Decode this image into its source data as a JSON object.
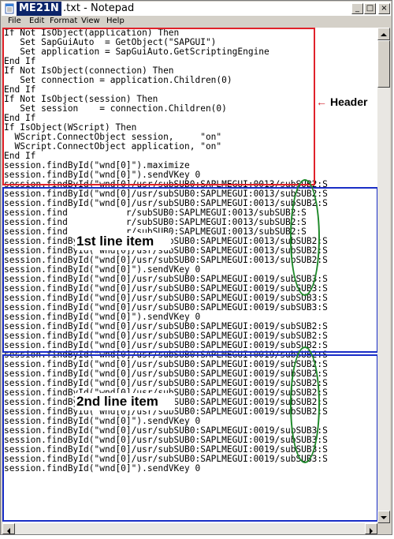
{
  "window": {
    "title_bold": "ME21N",
    "title_rest": ".txt - Notepad",
    "buttons": {
      "minimize": "_",
      "maximize": "□",
      "close": "×"
    }
  },
  "menu": [
    "File",
    "Edit",
    "Format",
    "View",
    "Help"
  ],
  "code_lines": [
    "If Not IsObject(application) Then",
    "   Set SapGuiAuto  = GetObject(\"SAPGUI\")",
    "   Set application = SapGuiAuto.GetScriptingEngine",
    "End If",
    "If Not IsObject(connection) Then",
    "   Set connection = application.Children(0)",
    "End If",
    "If Not IsObject(session) Then",
    "   Set session    = connection.Children(0)",
    "End If",
    "If IsObject(WScript) Then",
    "  WScript.ConnectObject session,     \"on\"",
    "  WScript.ConnectObject application, \"on\"",
    "End If",
    "session.findById(\"wnd[0]\").maximize",
    "session.findById(\"wnd[0]\").sendVKey 0",
    "session.findById(\"wnd[0]/usr/subSUB0:SAPLMEGUI:0013/subSUB2:S",
    "session.findById(\"wnd[0]/usr/subSUB0:SAPLMEGUI:0013/subSUB2:S",
    "session.findById(\"wnd[0]/usr/subSUB0:SAPLMEGUI:0013/subSUB2:S",
    "session.find           r/subSUB0:SAPLMEGUI:0013/subSUB2:S",
    "session.find           r/subSUB0:SAPLMEGUI:0013/subSUB2:S",
    "session.find           r/subSUB0:SAPLMEGUI:0013/subSUB2:S",
    "session.findById(\"wnd[0]/usr/subSUB0:SAPLMEGUI:0013/subSUB2:S",
    "session.findById(\"wnd[0]/usr/subSUB0:SAPLMEGUI:0013/subSUB2:S",
    "session.findById(\"wnd[0]/usr/subSUB0:SAPLMEGUI:0013/subSUB2:S",
    "session.findById(\"wnd[0]\").sendVKey 0",
    "session.findById(\"wnd[0]/usr/subSUB0:SAPLMEGUI:0019/subSUB3:S",
    "session.findById(\"wnd[0]/usr/subSUB0:SAPLMEGUI:0019/subSUB3:S",
    "session.findById(\"wnd[0]/usr/subSUB0:SAPLMEGUI:0019/subSUB3:S",
    "session.findById(\"wnd[0]/usr/subSUB0:SAPLMEGUI:0019/subSUB3:S",
    "session.findById(\"wnd[0]\").sendVKey 0",
    "session.findById(\"wnd[0]/usr/subSUB0:SAPLMEGUI:0019/subSUB2:S",
    "session.findById(\"wnd[0]/usr/subSUB0:SAPLMEGUI:0019/subSUB2:S",
    "session.findById(\"wnd[0]/usr/subSUB0:SAPLMEGUI:0019/subSUB2:S",
    "session.findById(\"wnd[0]/usr/subSUB0:SAPLMEGUI:0019/subSUB2:S",
    "session.findById(\"wnd[0]/usr/subSUB0:SAPLMEGUI:0019/subSUB2:S",
    "session.findById(\"wnd[0]/usr/subSUB0:SAPLMEGUI:0019/subSUB2:S",
    "session.findById(\"wnd[0]/usr/subSUB0:SAPLMEGUI:0019/subSUB2:S",
    "session.findById(\"wnd[0]/usr/subSUB0:SAPLMEGUI:0019/subSUB2:S",
    "session.findById(\"wnd[0]/usr/subSUB0:SAPLMEGUI:0019/subSUB2:S",
    "session.findById(\"wnd[0]/usr/subSUB0:SAPLMEGUI:0019/subSUB2:S",
    "session.findById(\"wnd[0]\").sendVKey 0",
    "session.findById(\"wnd[0]/usr/subSUB0:SAPLMEGUI:0019/subSUB3:S",
    "session.findById(\"wnd[0]/usr/subSUB0:SAPLMEGUI:0019/subSUB3:S",
    "session.findById(\"wnd[0]/usr/subSUB0:SAPLMEGUI:0019/subSUB3:S",
    "session.findById(\"wnd[0]/usr/subSUB0:SAPLMEGUI:0019/subSUB3:S",
    "session.findById(\"wnd[0]\").sendVKey 0"
  ],
  "annotations": {
    "header_label": "Header",
    "header_arrow": "←",
    "line_item_1": "1st line item",
    "line_item_2": "2nd line item"
  },
  "colors": {
    "header_box": "#e0222a",
    "line_item_box": "#1a2ec6",
    "highlight_oval": "#1f8a2a"
  },
  "icons": {
    "app": "notepad-icon",
    "scroll_up": "arrow-up-icon",
    "scroll_down": "arrow-down-icon",
    "scroll_left": "arrow-left-icon",
    "scroll_right": "arrow-right-icon"
  }
}
